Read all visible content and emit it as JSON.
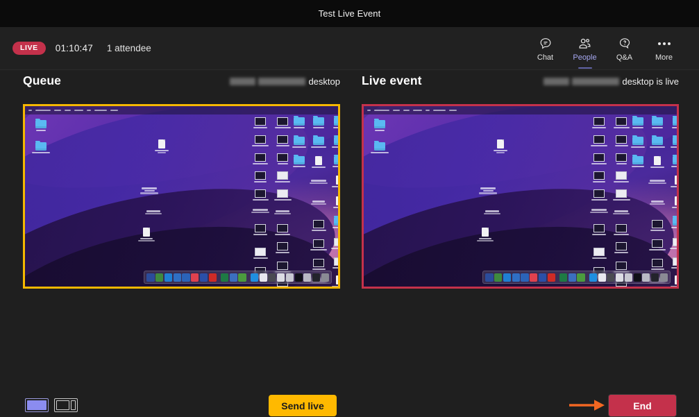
{
  "window": {
    "title": "Test Live Event"
  },
  "toolbar": {
    "live_badge": "LIVE",
    "timer": "01:10:47",
    "attendees": "1 attendee",
    "items": [
      {
        "icon": "chat-icon",
        "label": "Chat",
        "active": false
      },
      {
        "icon": "people-icon",
        "label": "People",
        "active": true
      },
      {
        "icon": "qa-icon",
        "label": "Q&A",
        "active": false
      },
      {
        "icon": "more-icon",
        "label": "More",
        "active": false
      }
    ]
  },
  "queue_panel": {
    "title": "Queue",
    "source_suffix": "desktop",
    "source_name_redacted": true,
    "border_color": "#f5b700"
  },
  "live_panel": {
    "title": "Live event",
    "source_suffix": "desktop is live",
    "source_name_redacted": true,
    "border_color": "#c4314b"
  },
  "controls": {
    "layout_full_label": "full-screen layout",
    "layout_split_label": "split layout",
    "send_live_label": "Send live",
    "end_label": "End",
    "annotation_arrow": "orange-arrow",
    "send_live_color": "#ffb900",
    "end_color": "#c4314b",
    "arrow_color": "#f26722"
  },
  "desktop_preview": {
    "os": "macOS",
    "wallpaper": "purple-gradient-waves",
    "dock_icons": [
      "#2b4c9b",
      "#3f8a3f",
      "#1f7fd4",
      "#2f6fc4",
      "#2b63b8",
      "#e0414e",
      "#2a4fa8",
      "#cf2b26",
      "#1e7a44",
      "#3b6fbf",
      "#4b9b3e",
      "#1f8fe0",
      "#e8e8ee",
      "#4a4a52",
      "#dcdce4",
      "#101018",
      "#b9b9c4",
      "#23232c",
      "#8a8a94"
    ]
  }
}
